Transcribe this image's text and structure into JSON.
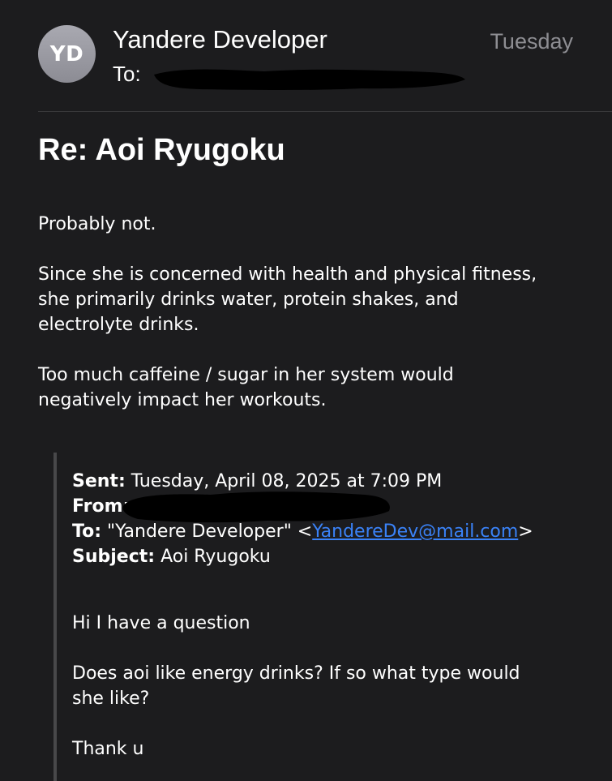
{
  "header": {
    "avatar_initials": "YD",
    "sender_name": "Yandere Developer",
    "date": "Tuesday",
    "to_label": "To:"
  },
  "subject": "Re: Aoi Ryugoku",
  "body": {
    "paragraphs": [
      "Probably not.",
      "Since she is concerned with health and physical fitness,\nshe primarily drinks water, protein shakes, and\nelectrolyte drinks.",
      "Too much caffeine / sugar in her system would\nnegatively impact her workouts."
    ]
  },
  "quoted": {
    "sent_label": "Sent:",
    "sent_value": "Tuesday, April 08, 2025 at 7:09 PM",
    "from_label": "From:",
    "to_label": "To:",
    "to_name": "\"Yandere Developer\" <",
    "to_email": "YandereDev@mail.com",
    "to_close": ">",
    "subject_label": "Subject:",
    "subject_value": "Aoi Ryugoku",
    "paragraphs": [
      "Hi I have a question",
      "Does aoi like energy drinks? If so what type would\nshe like?",
      "Thank u"
    ]
  },
  "colors": {
    "background": "#1c1c1e",
    "secondary_text": "#8e8e93",
    "link": "#3a82f7",
    "redaction": "#000000"
  }
}
